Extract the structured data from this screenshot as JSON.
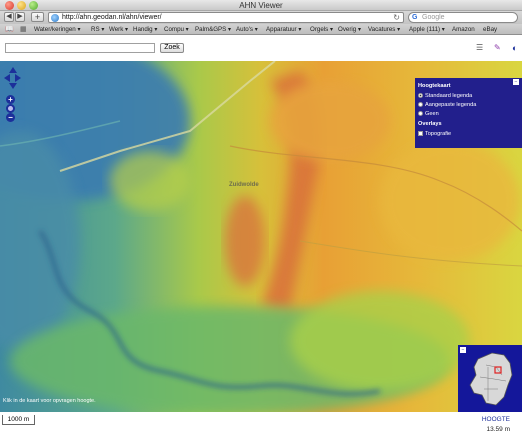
{
  "window": {
    "title": "AHN Viewer"
  },
  "browser": {
    "url": "http://ahn.geodan.nl/ahn/viewer/",
    "search_placeholder": "Google",
    "bookmarks": [
      "Water/keringen ▾",
      "RS ▾",
      "Werk ▾",
      "Handig ▾",
      "Compu ▾",
      "Palm&GPS ▾",
      "Auto's ▾",
      "Apparatuur ▾",
      "Orgels ▾",
      "Overig ▾",
      "Vacatures ▾",
      "Apple (111) ▾",
      "Amazon",
      "eBay"
    ]
  },
  "page": {
    "search_value": "",
    "search_button": "Zoek"
  },
  "map": {
    "place_labels": [
      {
        "id": "zuidwolde",
        "text": "Zuidwolde"
      }
    ],
    "hint": "Klik in de kaart voor opvragen hoogte.",
    "layer_panel": {
      "heading": "Hoogtekaart",
      "options": [
        "Standaard legenda",
        "Aangepaste legenda",
        "Geen"
      ],
      "selected": "Standaard legenda",
      "overlays_heading": "Overlays",
      "overlays": [
        "Topografie"
      ]
    }
  },
  "footer": {
    "scale": "1000 m",
    "height_label": "HOOGTE",
    "height_value": "13.59 m"
  },
  "colors": {
    "panel": "#221f8c",
    "controls": "#1c2f9a",
    "overview": "#14179a"
  }
}
